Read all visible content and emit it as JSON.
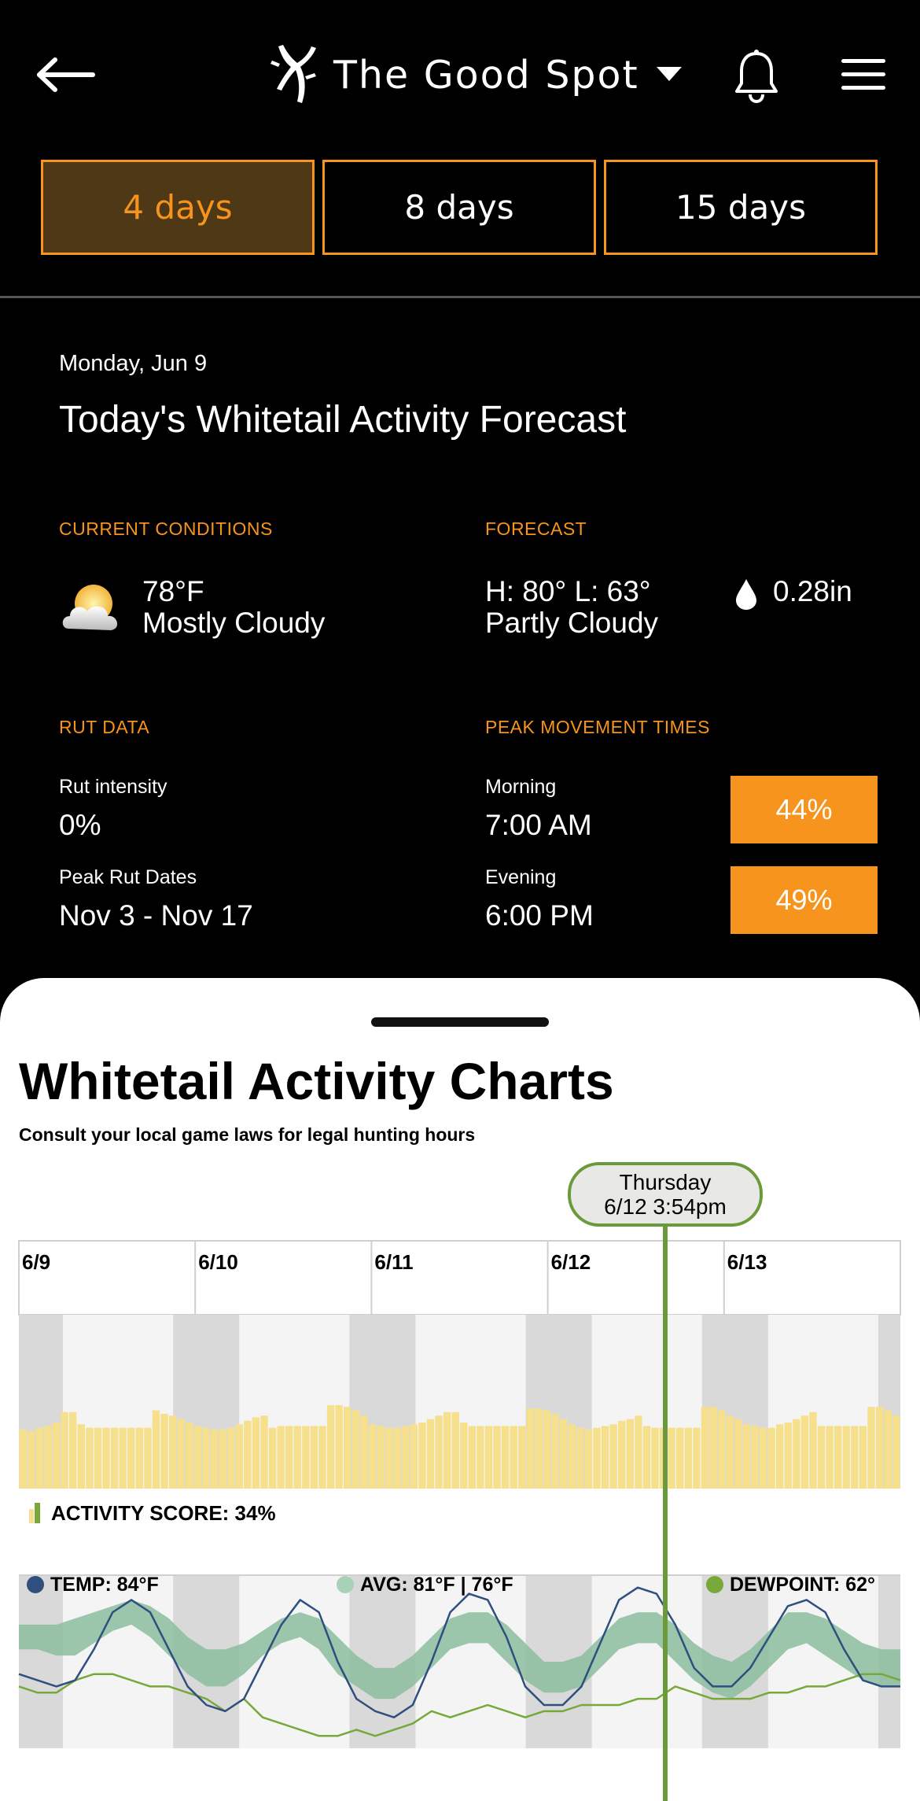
{
  "header": {
    "title": "The Good Spot",
    "icons": {
      "back": "arrow-left-icon",
      "logo": "antler-logo-icon",
      "caret": "caret-down-icon",
      "bell": "bell-icon",
      "menu": "hamburger-menu-icon"
    }
  },
  "tabs": [
    {
      "label": "4 days",
      "active": true
    },
    {
      "label": "8 days",
      "active": false
    },
    {
      "label": "15 days",
      "active": false
    }
  ],
  "summary": {
    "date": "Monday, Jun 9",
    "headline": "Today's Whitetail Activity Forecast",
    "current_conditions": {
      "label": "CURRENT CONDITIONS",
      "temp": "78°F",
      "condition": "Mostly Cloudy",
      "icon": "partly-cloudy-sun-icon"
    },
    "forecast": {
      "label": "FORECAST",
      "hilo": "H: 80° L: 63°",
      "condition": "Partly Cloudy",
      "precip": "0.28in",
      "precip_icon": "raindrop-icon"
    },
    "rut_data": {
      "label": "RUT DATA",
      "intensity_label": "Rut intensity",
      "intensity_value": "0%",
      "peak_label": "Peak Rut Dates",
      "peak_value": "Nov 3 - Nov 17"
    },
    "peak_movement": {
      "label": "PEAK MOVEMENT TIMES",
      "morning_label": "Morning",
      "morning_time": "7:00 AM",
      "morning_pct": "44%",
      "evening_label": "Evening",
      "evening_time": "6:00 PM",
      "evening_pct": "49%"
    }
  },
  "charts": {
    "title": "Whitetail Activity Charts",
    "note": "Consult your local game laws for legal hunting hours",
    "cursor_day": "Thursday",
    "cursor_time": "6/12 3:54pm",
    "day_labels": [
      "6/9",
      "6/10",
      "6/11",
      "6/12",
      "6/13"
    ],
    "activity_label": "ACTIVITY SCORE: 34%",
    "legend": {
      "temp": "TEMP: 84°F",
      "avg": "AVG: 81°F |  76°F",
      "dewpoint": "DEWPOINT: 62°"
    },
    "colors": {
      "activity_bar": "#f6e08c",
      "temp_line": "#2f4f7f",
      "avg_band": "#8bbd9f",
      "dewpoint_line": "#79a83a",
      "cursor": "#6a9a3a",
      "night_shade": "#d9d9d9",
      "day_shade": "#f4f4f4"
    }
  },
  "chart_data": [
    {
      "type": "bar",
      "title": "",
      "series": [
        {
          "name": "ACTIVITY SCORE",
          "values": [
            34,
            33,
            35,
            36,
            38,
            44,
            44,
            37,
            35,
            35,
            35,
            35,
            35,
            35,
            35,
            35,
            45,
            43,
            42,
            40,
            38,
            36,
            35,
            34,
            34,
            35,
            37,
            39,
            41,
            42,
            35,
            36,
            36,
            36,
            36,
            36,
            36,
            48,
            48,
            47,
            45,
            42,
            37,
            36,
            35,
            35,
            36,
            37,
            38,
            40,
            42,
            44,
            44,
            38,
            36,
            36,
            36,
            36,
            36,
            36,
            36,
            46,
            46,
            45,
            43,
            40,
            37,
            35,
            34,
            35,
            36,
            37,
            39,
            40,
            42,
            36,
            35,
            35,
            35,
            35,
            35,
            35,
            47,
            47,
            45,
            42,
            40,
            37,
            36,
            35,
            35,
            37,
            38,
            40,
            42,
            44,
            36,
            36,
            36,
            36,
            36,
            36,
            47,
            47,
            45,
            42
          ]
        }
      ],
      "x": {
        "start": "6/9",
        "end": "6/13",
        "labels": [
          "6/9",
          "6/10",
          "6/11",
          "6/12",
          "6/13"
        ]
      },
      "ylim": [
        0,
        100
      ]
    },
    {
      "type": "line",
      "title": "",
      "x": {
        "labels": [
          "6/9",
          "6/10",
          "6/11",
          "6/12",
          "6/13"
        ]
      },
      "series": [
        {
          "name": "TEMP",
          "values": [
            72,
            71,
            70,
            71,
            76,
            82,
            84,
            82,
            76,
            70,
            67,
            66,
            68,
            74,
            80,
            84,
            82,
            74,
            68,
            66,
            65,
            67,
            74,
            82,
            85,
            84,
            78,
            70,
            67,
            67,
            70,
            77,
            84,
            86,
            85,
            80,
            73,
            70,
            70,
            73,
            78,
            83,
            84,
            82,
            76,
            71,
            70,
            70
          ]
        },
        {
          "name": "AVG HIGH",
          "values": [
            80,
            80,
            80,
            81,
            82,
            83,
            84,
            83,
            81,
            78,
            76,
            76,
            77,
            79,
            81,
            82,
            81,
            78,
            75,
            73,
            73,
            75,
            78,
            81,
            82,
            82,
            80,
            77,
            74,
            74,
            75,
            78,
            81,
            82,
            82,
            80,
            77,
            75,
            74,
            76,
            79,
            82,
            82,
            81,
            79,
            77,
            76,
            76
          ]
        },
        {
          "name": "AVG LOW",
          "values": [
            76,
            76,
            75,
            75,
            77,
            79,
            80,
            78,
            75,
            72,
            70,
            70,
            72,
            75,
            77,
            78,
            76,
            72,
            70,
            68,
            68,
            70,
            73,
            76,
            77,
            77,
            74,
            71,
            69,
            69,
            70,
            73,
            76,
            77,
            77,
            74,
            71,
            69,
            68,
            70,
            73,
            76,
            77,
            75,
            73,
            71,
            70,
            70
          ]
        },
        {
          "name": "DEWPOINT",
          "values": [
            70,
            69,
            69,
            71,
            72,
            72,
            71,
            70,
            70,
            69,
            68,
            66,
            68,
            65,
            64,
            63,
            62,
            62,
            63,
            62,
            63,
            64,
            66,
            65,
            66,
            67,
            66,
            65,
            66,
            66,
            67,
            67,
            67,
            68,
            68,
            70,
            69,
            68,
            68,
            68,
            69,
            69,
            70,
            70,
            71,
            72,
            72,
            71
          ]
        }
      ]
    }
  ]
}
